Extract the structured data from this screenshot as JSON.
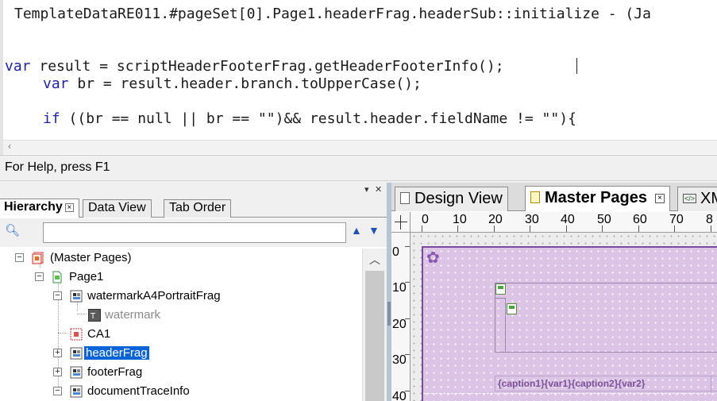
{
  "editor": {
    "header_line": "TemplateDataRE011.#pageSet[0].Page1.headerFrag.headerSub::initialize - (Ja",
    "line2_kw": "var",
    "line2_rest": " result = scriptHeaderFooterFrag.getHeaderFooterInfo();",
    "line3_kw": "var",
    "line3_rest": " br = result.header.branch.toUpperCase();",
    "line4_kw": "if",
    "line4_rest": " ((br == null || br == \"\")&& result.header.fieldName != \"\"){"
  },
  "status": {
    "help_text": "For Help, press F1"
  },
  "left_panel": {
    "tabs": [
      {
        "label": "Hierarchy",
        "active": true
      },
      {
        "label": "Data View",
        "active": false
      },
      {
        "label": "Tab Order",
        "active": false
      }
    ],
    "search": {
      "value": "",
      "placeholder": ""
    },
    "tree": [
      {
        "label": "(Master Pages)",
        "icon": "master-pages-icon",
        "expander": "-"
      },
      {
        "label": "Page1",
        "icon": "page-icon",
        "expander": "-"
      },
      {
        "label": "watermarkA4PortraitFrag",
        "icon": "subform-icon",
        "expander": "-"
      },
      {
        "label": "watermark",
        "icon": "text-field-icon",
        "expander": ""
      },
      {
        "label": "CA1",
        "icon": "content-area-icon",
        "expander": ""
      },
      {
        "label": "headerFrag",
        "icon": "subform-icon",
        "expander": "+"
      },
      {
        "label": "footerFrag",
        "icon": "subform-icon",
        "expander": "+"
      },
      {
        "label": "documentTraceInfo",
        "icon": "subform-icon",
        "expander": "-"
      }
    ]
  },
  "right_panel": {
    "tabs": [
      {
        "label": "Design View",
        "active": false
      },
      {
        "label": "Master Pages",
        "active": true
      },
      {
        "label": "XM",
        "active": false
      }
    ],
    "ruler_h": [
      "0",
      "10",
      "20",
      "30",
      "40",
      "50",
      "60",
      "70",
      "8"
    ],
    "ruler_v": [
      "0",
      "10",
      "20",
      "30",
      "40"
    ],
    "caption_text": "{caption1}{var1}{caption2}{var2}"
  },
  "colors": {
    "selection": "#0a64d8",
    "page_fill": "#dcc4e6",
    "page_border": "#7a4ca0",
    "keyword": "#1e22a8"
  }
}
